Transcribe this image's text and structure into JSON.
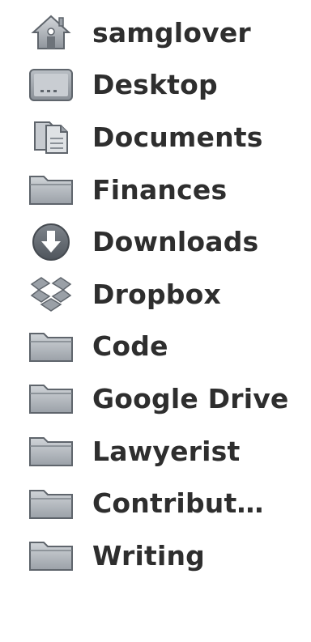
{
  "sidebar": {
    "items": [
      {
        "label": "samglover",
        "icon": "home-icon"
      },
      {
        "label": "Desktop",
        "icon": "desktop-icon"
      },
      {
        "label": "Documents",
        "icon": "documents-icon"
      },
      {
        "label": "Finances",
        "icon": "folder-icon"
      },
      {
        "label": "Downloads",
        "icon": "downloads-icon"
      },
      {
        "label": "Dropbox",
        "icon": "dropbox-icon"
      },
      {
        "label": "Code",
        "icon": "folder-icon"
      },
      {
        "label": "Google Drive",
        "icon": "folder-icon"
      },
      {
        "label": "Lawyerist",
        "icon": "folder-icon"
      },
      {
        "label": "Contribut…",
        "icon": "folder-icon"
      },
      {
        "label": "Writing",
        "icon": "folder-icon"
      }
    ]
  },
  "colors": {
    "text": "#2e2e2e",
    "icon_fill": "#a8adb3",
    "icon_stroke": "#5f656c"
  }
}
